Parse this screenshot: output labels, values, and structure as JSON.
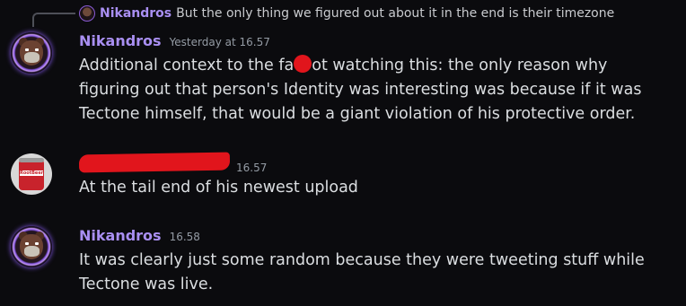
{
  "reply": {
    "username": "Nikandros",
    "text": "But the only thing we figured out about it in the end is their timezone",
    "avatar_icon": "bear-avatar-icon"
  },
  "messages": [
    {
      "username": "Nikandros",
      "timestamp": "Yesterday at 16.57",
      "content_before": "Additional context to the fa",
      "content_after": "ot watching this: the only reason why figuring out that person's Identity was interesting was because if it was Tectone himself, that would be a giant violation of his protective order.",
      "avatar_icon": "bear-avatar-icon"
    },
    {
      "username": "",
      "timestamp": "16.57",
      "content": "At the tail end of his newest upload",
      "avatar_icon": "soda-can-avatar-icon",
      "avatar_label": "RootBeer"
    },
    {
      "username": "Nikandros",
      "timestamp": "16.58",
      "content": "It was clearly just some random because they were tweeting stuff while Tectone was live.",
      "avatar_icon": "bear-avatar-icon"
    }
  ],
  "colors": {
    "background": "#0b0b0e",
    "username": "#a98ff2",
    "text": "#dbdee1",
    "timestamp": "#949ba4",
    "redaction": "#e1151c"
  }
}
